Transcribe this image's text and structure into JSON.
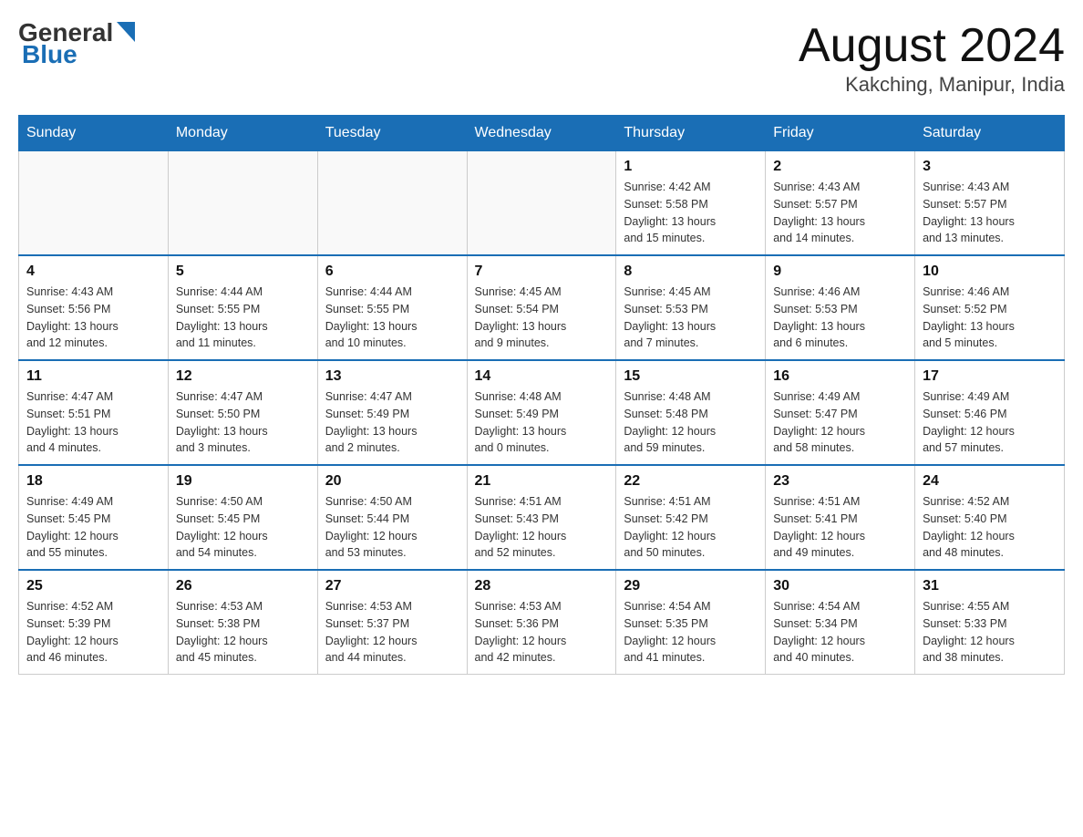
{
  "header": {
    "logo_general": "General",
    "logo_blue": "Blue",
    "title": "August 2024",
    "location": "Kakching, Manipur, India"
  },
  "weekdays": [
    "Sunday",
    "Monday",
    "Tuesday",
    "Wednesday",
    "Thursday",
    "Friday",
    "Saturday"
  ],
  "weeks": [
    [
      {
        "day": "",
        "info": ""
      },
      {
        "day": "",
        "info": ""
      },
      {
        "day": "",
        "info": ""
      },
      {
        "day": "",
        "info": ""
      },
      {
        "day": "1",
        "info": "Sunrise: 4:42 AM\nSunset: 5:58 PM\nDaylight: 13 hours\nand 15 minutes."
      },
      {
        "day": "2",
        "info": "Sunrise: 4:43 AM\nSunset: 5:57 PM\nDaylight: 13 hours\nand 14 minutes."
      },
      {
        "day": "3",
        "info": "Sunrise: 4:43 AM\nSunset: 5:57 PM\nDaylight: 13 hours\nand 13 minutes."
      }
    ],
    [
      {
        "day": "4",
        "info": "Sunrise: 4:43 AM\nSunset: 5:56 PM\nDaylight: 13 hours\nand 12 minutes."
      },
      {
        "day": "5",
        "info": "Sunrise: 4:44 AM\nSunset: 5:55 PM\nDaylight: 13 hours\nand 11 minutes."
      },
      {
        "day": "6",
        "info": "Sunrise: 4:44 AM\nSunset: 5:55 PM\nDaylight: 13 hours\nand 10 minutes."
      },
      {
        "day": "7",
        "info": "Sunrise: 4:45 AM\nSunset: 5:54 PM\nDaylight: 13 hours\nand 9 minutes."
      },
      {
        "day": "8",
        "info": "Sunrise: 4:45 AM\nSunset: 5:53 PM\nDaylight: 13 hours\nand 7 minutes."
      },
      {
        "day": "9",
        "info": "Sunrise: 4:46 AM\nSunset: 5:53 PM\nDaylight: 13 hours\nand 6 minutes."
      },
      {
        "day": "10",
        "info": "Sunrise: 4:46 AM\nSunset: 5:52 PM\nDaylight: 13 hours\nand 5 minutes."
      }
    ],
    [
      {
        "day": "11",
        "info": "Sunrise: 4:47 AM\nSunset: 5:51 PM\nDaylight: 13 hours\nand 4 minutes."
      },
      {
        "day": "12",
        "info": "Sunrise: 4:47 AM\nSunset: 5:50 PM\nDaylight: 13 hours\nand 3 minutes."
      },
      {
        "day": "13",
        "info": "Sunrise: 4:47 AM\nSunset: 5:49 PM\nDaylight: 13 hours\nand 2 minutes."
      },
      {
        "day": "14",
        "info": "Sunrise: 4:48 AM\nSunset: 5:49 PM\nDaylight: 13 hours\nand 0 minutes."
      },
      {
        "day": "15",
        "info": "Sunrise: 4:48 AM\nSunset: 5:48 PM\nDaylight: 12 hours\nand 59 minutes."
      },
      {
        "day": "16",
        "info": "Sunrise: 4:49 AM\nSunset: 5:47 PM\nDaylight: 12 hours\nand 58 minutes."
      },
      {
        "day": "17",
        "info": "Sunrise: 4:49 AM\nSunset: 5:46 PM\nDaylight: 12 hours\nand 57 minutes."
      }
    ],
    [
      {
        "day": "18",
        "info": "Sunrise: 4:49 AM\nSunset: 5:45 PM\nDaylight: 12 hours\nand 55 minutes."
      },
      {
        "day": "19",
        "info": "Sunrise: 4:50 AM\nSunset: 5:45 PM\nDaylight: 12 hours\nand 54 minutes."
      },
      {
        "day": "20",
        "info": "Sunrise: 4:50 AM\nSunset: 5:44 PM\nDaylight: 12 hours\nand 53 minutes."
      },
      {
        "day": "21",
        "info": "Sunrise: 4:51 AM\nSunset: 5:43 PM\nDaylight: 12 hours\nand 52 minutes."
      },
      {
        "day": "22",
        "info": "Sunrise: 4:51 AM\nSunset: 5:42 PM\nDaylight: 12 hours\nand 50 minutes."
      },
      {
        "day": "23",
        "info": "Sunrise: 4:51 AM\nSunset: 5:41 PM\nDaylight: 12 hours\nand 49 minutes."
      },
      {
        "day": "24",
        "info": "Sunrise: 4:52 AM\nSunset: 5:40 PM\nDaylight: 12 hours\nand 48 minutes."
      }
    ],
    [
      {
        "day": "25",
        "info": "Sunrise: 4:52 AM\nSunset: 5:39 PM\nDaylight: 12 hours\nand 46 minutes."
      },
      {
        "day": "26",
        "info": "Sunrise: 4:53 AM\nSunset: 5:38 PM\nDaylight: 12 hours\nand 45 minutes."
      },
      {
        "day": "27",
        "info": "Sunrise: 4:53 AM\nSunset: 5:37 PM\nDaylight: 12 hours\nand 44 minutes."
      },
      {
        "day": "28",
        "info": "Sunrise: 4:53 AM\nSunset: 5:36 PM\nDaylight: 12 hours\nand 42 minutes."
      },
      {
        "day": "29",
        "info": "Sunrise: 4:54 AM\nSunset: 5:35 PM\nDaylight: 12 hours\nand 41 minutes."
      },
      {
        "day": "30",
        "info": "Sunrise: 4:54 AM\nSunset: 5:34 PM\nDaylight: 12 hours\nand 40 minutes."
      },
      {
        "day": "31",
        "info": "Sunrise: 4:55 AM\nSunset: 5:33 PM\nDaylight: 12 hours\nand 38 minutes."
      }
    ]
  ]
}
